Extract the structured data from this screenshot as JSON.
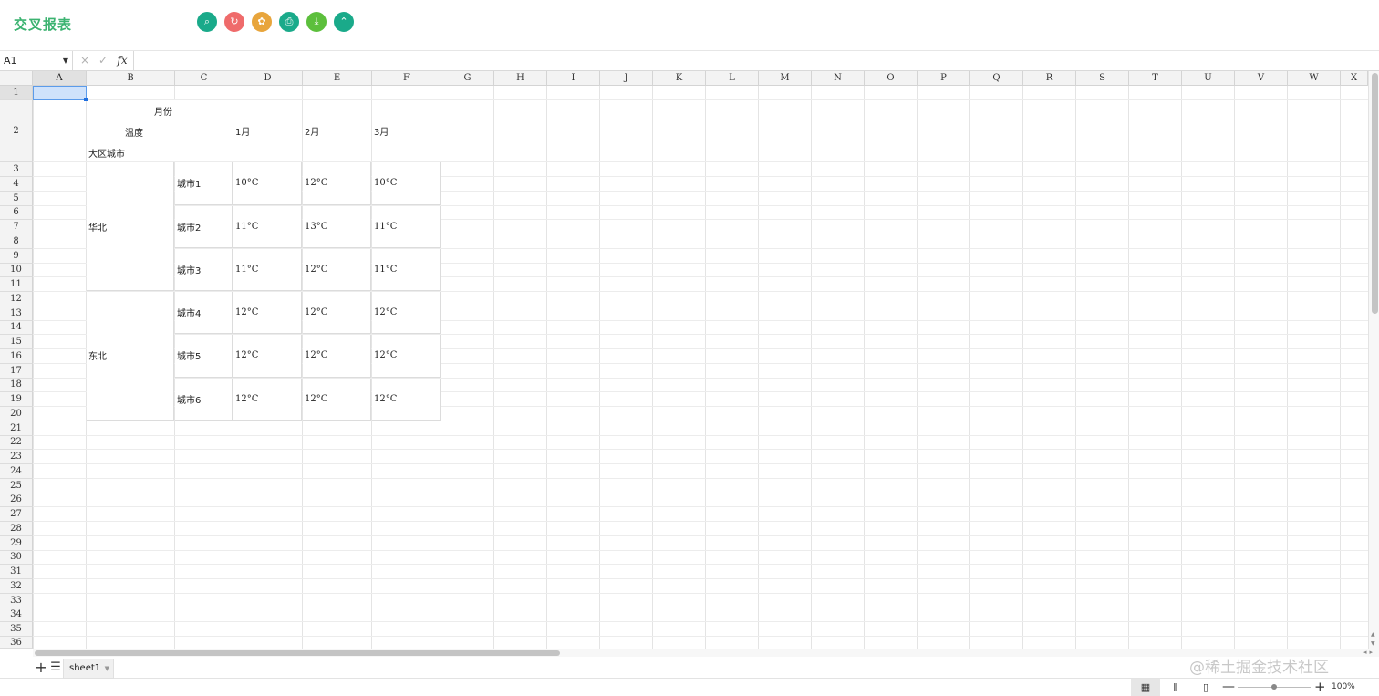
{
  "header": {
    "title": "交叉报表",
    "buttons": [
      {
        "name": "search-icon",
        "glyph": "⌕",
        "color": "#1aaa8a"
      },
      {
        "name": "refresh-icon",
        "glyph": "↻",
        "color": "#ef6b6b"
      },
      {
        "name": "palette-icon",
        "glyph": "✿",
        "color": "#e8a53c"
      },
      {
        "name": "print-icon",
        "glyph": "⎙",
        "color": "#1aaa8a"
      },
      {
        "name": "download-icon",
        "glyph": "⤓",
        "color": "#5cbf3c"
      },
      {
        "name": "collapse-icon",
        "glyph": "⌃",
        "color": "#1aaa8a"
      }
    ]
  },
  "formula_bar": {
    "cell_ref": "A1",
    "cancel_icon": "×",
    "confirm_icon": "✓",
    "fx_label": "fx",
    "formula_value": ""
  },
  "grid": {
    "columns": [
      "A",
      "B",
      "C",
      "D",
      "E",
      "F",
      "G",
      "H",
      "I",
      "J",
      "K",
      "L",
      "M",
      "N",
      "O",
      "P",
      "Q",
      "R",
      "S",
      "T",
      "U",
      "V",
      "W",
      "X"
    ],
    "rows": [
      "1",
      "2",
      "3",
      "4",
      "5",
      "6",
      "7",
      "8",
      "9",
      "10",
      "11",
      "12",
      "13",
      "14",
      "15",
      "16",
      "17",
      "18",
      "19",
      "20",
      "21",
      "22",
      "23",
      "24",
      "25",
      "26",
      "27",
      "28",
      "29",
      "30",
      "31",
      "32",
      "33",
      "34",
      "35",
      "36"
    ],
    "selected": "A1"
  },
  "report": {
    "header_month": "月份",
    "header_temp": "温度",
    "header_region_city": "大区城市",
    "months": [
      "1月",
      "2月",
      "3月"
    ],
    "regions": [
      {
        "name": "华北",
        "cities": [
          {
            "name": "城市1",
            "temps": [
              "10°C",
              "12°C",
              "10°C"
            ]
          },
          {
            "name": "城市2",
            "temps": [
              "11°C",
              "13°C",
              "11°C"
            ]
          },
          {
            "name": "城市3",
            "temps": [
              "11°C",
              "12°C",
              "11°C"
            ]
          }
        ]
      },
      {
        "name": "东北",
        "cities": [
          {
            "name": "城市4",
            "temps": [
              "12°C",
              "12°C",
              "12°C"
            ]
          },
          {
            "name": "城市5",
            "temps": [
              "12°C",
              "12°C",
              "12°C"
            ]
          },
          {
            "name": "城市6",
            "temps": [
              "12°C",
              "12°C",
              "12°C"
            ]
          }
        ]
      }
    ]
  },
  "sheets": {
    "add_label": "+",
    "list_label": "☰",
    "tabs": [
      "sheet1"
    ],
    "watermark": "@稀土掘金技术社区"
  },
  "status": {
    "view_normal": "▦",
    "view_layout": "Ⅱ",
    "view_pagebreak": "▯",
    "zoom_minus": "—",
    "zoom_plus": "+",
    "zoom": "100%",
    "zoom_level": 1.0
  }
}
